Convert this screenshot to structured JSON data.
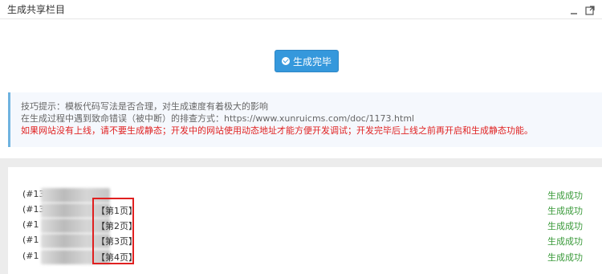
{
  "header": {
    "title": "生成共享栏目",
    "minimize_icon": "minimize-icon",
    "maximize_icon": "maximize-icon"
  },
  "action": {
    "button_label": "生成完毕",
    "button_icon": "check-circle-icon"
  },
  "tips": {
    "line1": "技巧提示：模板代码写法是否合理，对生成速度有着极大的影响",
    "line2": "在生成过程中遇到致命错误（被中断）的排查方式：https://www.xunruicms.com/doc/1173.html",
    "line3": "如果网站没有上线，请不要生成静态；开发中的网站使用动态地址才能方便开发调试；开发完毕后上线之前再开启和生成静态功能。"
  },
  "rows": [
    {
      "prefix": "(#13",
      "page": "",
      "status": "生成成功"
    },
    {
      "prefix": "(#13",
      "page": "【第1页】",
      "status": "生成成功"
    },
    {
      "prefix": "(#1",
      "page": "【第2页】",
      "status": "生成成功"
    },
    {
      "prefix": "(#1",
      "page": "【第3页】",
      "status": "生成成功"
    },
    {
      "prefix": "(#1",
      "page": "【第4页】",
      "status": "生成成功"
    }
  ],
  "colors": {
    "primary": "#3598dc",
    "success": "#3a9a3a",
    "warning": "#e02222",
    "highlight_box": "#e02020"
  }
}
